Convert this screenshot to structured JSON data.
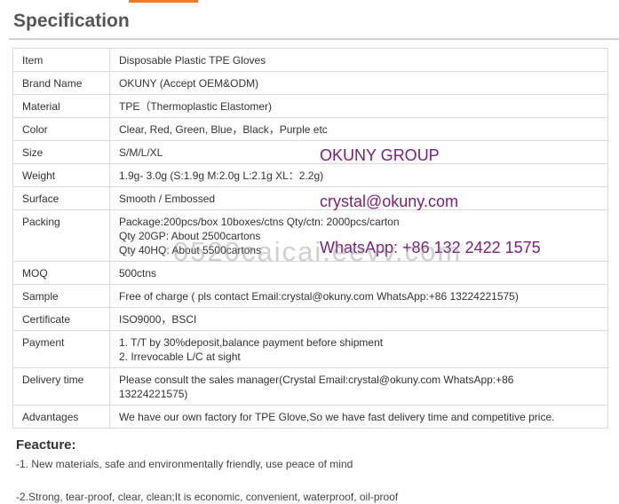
{
  "section_title": "Specification",
  "table": [
    {
      "key": "Item",
      "lines": [
        "Disposable Plastic TPE Gloves"
      ]
    },
    {
      "key": "Brand Name",
      "lines": [
        "OKUNY (Accept OEM&ODM)"
      ]
    },
    {
      "key": "Material",
      "lines": [
        "TPE（Thermoplastic Elastomer)"
      ]
    },
    {
      "key": "Color",
      "lines": [
        "Clear, Red, Green, Blue，Black，Purple etc"
      ]
    },
    {
      "key": "Size",
      "lines": [
        "S/M/L/XL"
      ]
    },
    {
      "key": "Weight",
      "lines": [
        "1.9g- 3.0g (S:1.9g M:2.0g L:2.1g XL：2.2g)"
      ]
    },
    {
      "key": "Surface",
      "lines": [
        "Smooth / Embossed"
      ]
    },
    {
      "key": "Packing",
      "lines": [
        "Package:200pcs/box 10boxes/ctns Qty/ctn: 2000pcs/carton",
        "Qty 20GP: About 2500cartons",
        "Qty 40HQ: About 5500cartons"
      ]
    },
    {
      "key": "MOQ",
      "lines": [
        "500ctns"
      ]
    },
    {
      "key": "Sample",
      "lines": [
        "Free of charge ( pls contact Email:crystal@okuny.com WhatsApp:+86 13224221575)"
      ]
    },
    {
      "key": "Certificate",
      "lines": [
        "ISO9000，BSCI"
      ]
    },
    {
      "key": "Payment",
      "lines": [
        "1. T/T by 30%deposit,balance payment before shipment",
        "2. Irrevocable L/C at sight"
      ]
    },
    {
      "key": "Delivery time",
      "lines": [
        "Please consult the sales manager(Crystal Email:crystal@okuny.com WhatsApp:+86",
        "13224221575)"
      ]
    },
    {
      "key": "Advantages",
      "lines": [
        "We have our own factory for TPE Glove,So we have fast delivery time and competitive price."
      ]
    }
  ],
  "overlay": {
    "group": "OKUNY GROUP",
    "email": "crystal@okuny.com",
    "whatsapp": "WhatsApp: +86 132 2422 1575",
    "color": "#7b1e7a"
  },
  "watermark": "0520caicai.eevv.com",
  "features": {
    "heading": "Feacture:",
    "items": [
      "-1. New materials, safe and environmentally friendly, use peace of mind",
      "-2.Strong, tear-proof, clear, clean;It is economic, convenient, waterproof, oil-proof"
    ]
  },
  "accent_color": "#f47b20"
}
